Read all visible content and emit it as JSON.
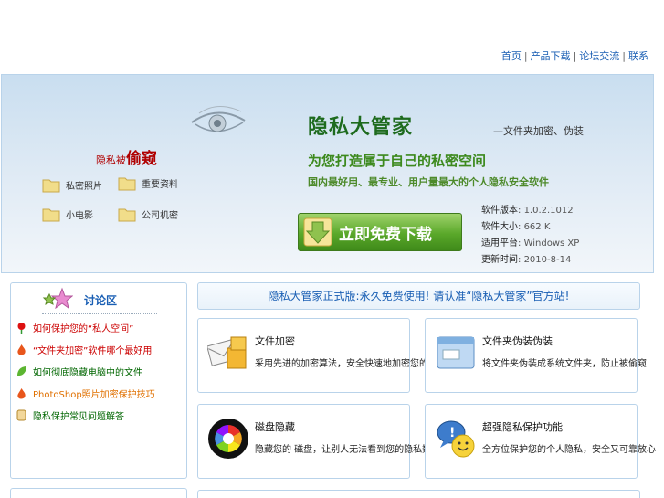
{
  "nav": {
    "items": [
      "首页",
      "产品下载",
      "论坛交流",
      "联系"
    ],
    "separator": "|"
  },
  "banner": {
    "tagline_small": "隐私被",
    "tagline_big": "偷窥",
    "folders": [
      "私密照片",
      "重要资料",
      "小电影",
      "公司机密"
    ],
    "brand_title": "隐私大管家",
    "brand_sub": "—文件夹加密、伪装",
    "slogan": "为您打造属于自己的私密空间",
    "description": "国内最好用、最专业、用户量最大的个人隐私安全软件",
    "download_label": "立即免费下载",
    "info": [
      {
        "key": "软件版本",
        "value": "1.0.2.1012"
      },
      {
        "key": "软件大小",
        "value": "662 K"
      },
      {
        "key": "适用平台",
        "value": "Windows XP"
      },
      {
        "key": "更新时间",
        "value": "2010-8-14"
      }
    ]
  },
  "forum": {
    "title": "讨论区",
    "items": [
      {
        "text": "如何保护您的“私人空间”",
        "color": "#cc0000",
        "icon": "rose-icon"
      },
      {
        "text": "“文件夹加密”软件哪个最好用",
        "color": "#cc0000",
        "icon": "flame-icon"
      },
      {
        "text": "如何彻底隐藏电脑中的文件",
        "color": "#006600",
        "icon": "leaf-icon"
      },
      {
        "text": "PhotoShop照片加密保护技巧",
        "color": "#e07000",
        "icon": "flame-icon"
      },
      {
        "text": "隐私保护常见问题解答",
        "color": "#006600",
        "icon": "scroll-icon"
      }
    ]
  },
  "announcement": "隐私大管家正式版:永久免费使用! 请认准“隐私大管家”官方站!",
  "features": [
    {
      "title": "文件加密",
      "desc": "采用先进的加密算法，安全快速地加密您的文件",
      "icon": "lock-envelope-icon"
    },
    {
      "title": "文件夹伪装伪装",
      "desc": "将文件夹伪装成系统文件夹，防止被偷窥",
      "icon": "window-icon"
    },
    {
      "title": "磁盘隐藏",
      "desc": "隐藏您的 磁盘，让别人无法看到您的隐私数据",
      "icon": "color-wheel-icon"
    },
    {
      "title": "超强隐私保护功能",
      "desc": "全方位保护您的个人隐私，安全又可靠放心",
      "icon": "chat-smiley-icon"
    }
  ]
}
